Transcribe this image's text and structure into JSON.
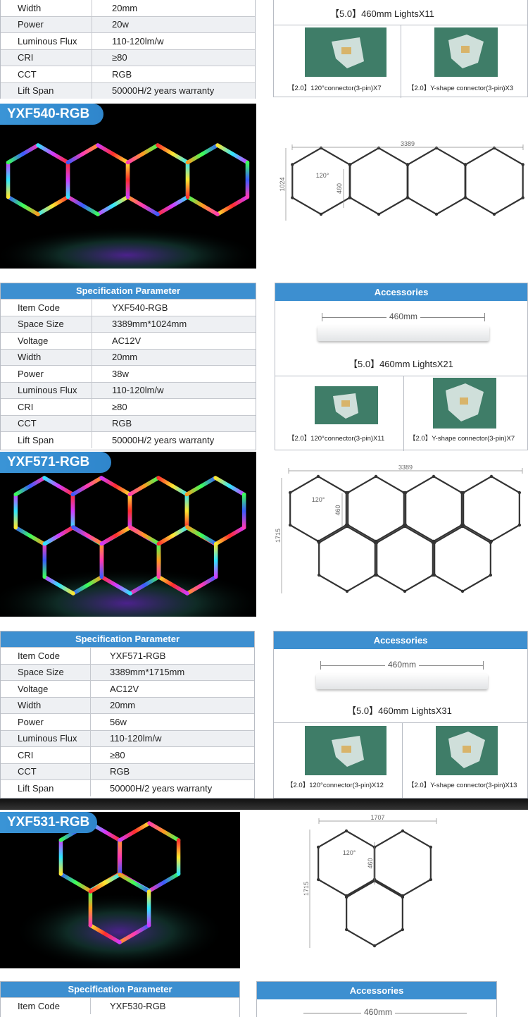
{
  "top": {
    "spec_rows": [
      {
        "k": "Width",
        "v": "20mm"
      },
      {
        "k": "Power",
        "v": "20w"
      },
      {
        "k": "Luminous Flux",
        "v": "110-120lm/w"
      },
      {
        "k": "CRI",
        "v": "≥80"
      },
      {
        "k": "CCT",
        "v": "RGB"
      },
      {
        "k": "Lift Span",
        "v": "50000H/2 years warranty"
      }
    ],
    "light_caption": "【5.0】460mm LightsX11",
    "conn1": "【2.0】120°connector(3-pin)X7",
    "conn2": "【2.0】Y-shape connector(3-pin)X3"
  },
  "sections": [
    {
      "badge": "YXF540-RGB",
      "drawing": {
        "width": "3389",
        "height": "1024",
        "angle": "120°",
        "side": "460"
      },
      "spec_title": "Specification Parameter",
      "acc_title": "Accessories",
      "bar_label": "460mm",
      "spec_rows": [
        {
          "k": "Item Code",
          "v": "YXF540-RGB"
        },
        {
          "k": "Space Size",
          "v": "3389mm*1024mm"
        },
        {
          "k": "Voltage",
          "v": "AC12V"
        },
        {
          "k": "Width",
          "v": "20mm"
        },
        {
          "k": "Power",
          "v": "38w"
        },
        {
          "k": "Luminous Flux",
          "v": "110-120lm/w"
        },
        {
          "k": "CRI",
          "v": "≥80"
        },
        {
          "k": "CCT",
          "v": "RGB"
        },
        {
          "k": "Lift Span",
          "v": "50000H/2 years warranty"
        }
      ],
      "light_caption": "【5.0】460mm LightsX21",
      "conn1": "【2.0】120°connector(3-pin)X11",
      "conn2": "【2.0】Y-shape connector(3-pin)X7"
    },
    {
      "badge": "YXF571-RGB",
      "drawing": {
        "width": "3389",
        "height": "1715",
        "angle": "120°",
        "side": "460"
      },
      "spec_title": "Specification Parameter",
      "acc_title": "Accessories",
      "bar_label": "460mm",
      "spec_rows": [
        {
          "k": "Item Code",
          "v": "YXF571-RGB"
        },
        {
          "k": "Space Size",
          "v": "3389mm*1715mm"
        },
        {
          "k": "Voltage",
          "v": "AC12V"
        },
        {
          "k": "Width",
          "v": "20mm"
        },
        {
          "k": "Power",
          "v": "56w"
        },
        {
          "k": "Luminous Flux",
          "v": "110-120lm/w"
        },
        {
          "k": "CRI",
          "v": "≥80"
        },
        {
          "k": "CCT",
          "v": "RGB"
        },
        {
          "k": "Lift Span",
          "v": "50000H/2 years warranty"
        }
      ],
      "light_caption": "【5.0】460mm LightsX31",
      "conn1": "【2.0】120°connector(3-pin)X12",
      "conn2": "【2.0】Y-shape connector(3-pin)X13"
    },
    {
      "badge": "YXF531-RGB",
      "drawing": {
        "width": "1707",
        "height": "1715",
        "angle": "120°",
        "side": "460"
      },
      "spec_title": "Specification Parameter",
      "acc_title": "Accessories",
      "bar_label": "460mm",
      "spec_rows": [
        {
          "k": "Item Code",
          "v": "YXF530-RGB"
        }
      ]
    }
  ],
  "colors": {
    "accent": "#3d8fd0",
    "row_alt": "#eef0f3",
    "connector_bg": "#3f7d68"
  }
}
